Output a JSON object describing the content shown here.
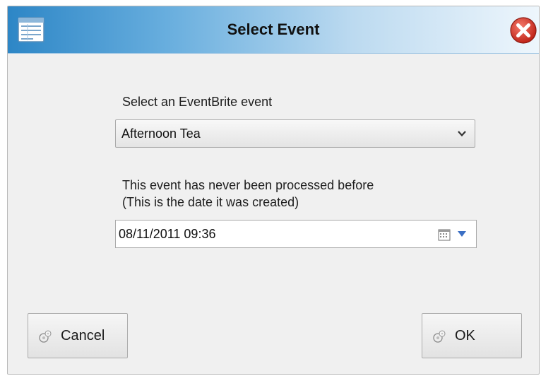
{
  "window": {
    "title": "Select Event",
    "icons": {
      "app": "form-icon",
      "close": "close-icon"
    }
  },
  "event_select": {
    "label": "Select an EventBrite event",
    "selected": "Afternoon Tea"
  },
  "processed": {
    "line1": "This event has never been processed before",
    "line2": "(This is the date it was created)",
    "date_value": "08/11/2011 09:36"
  },
  "buttons": {
    "cancel": "Cancel",
    "ok": "OK"
  },
  "colors": {
    "title_gradient_start": "#2d86c6",
    "close_red": "#d7342a",
    "background": "#f0f0f0"
  }
}
